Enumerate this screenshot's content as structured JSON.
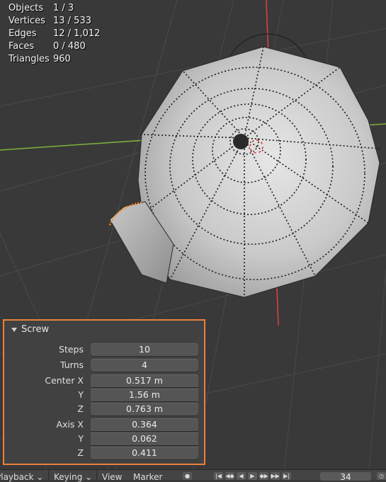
{
  "stats": {
    "objects_label": "Objects",
    "objects_value": "1 / 3",
    "vertices_label": "Vertices",
    "vertices_value": "13 / 533",
    "edges_label": "Edges",
    "edges_value": "12 / 1,012",
    "faces_label": "Faces",
    "faces_value": "0 / 480",
    "triangles_label": "Triangles",
    "triangles_value": "960"
  },
  "panel": {
    "title": "Screw",
    "steps_label": "Steps",
    "steps_value": "10",
    "turns_label": "Turns",
    "turns_value": "4",
    "center_x_label": "Center X",
    "center_x_value": "0.517 m",
    "center_y_label": "Y",
    "center_y_value": "1.56 m",
    "center_z_label": "Z",
    "center_z_value": "0.763 m",
    "axis_x_label": "Axis X",
    "axis_x_value": "0.364",
    "axis_y_label": "Y",
    "axis_y_value": "0.062",
    "axis_z_label": "Z",
    "axis_z_value": "0.411"
  },
  "timeline": {
    "playback": "Playback",
    "keying": "Keying",
    "view": "View",
    "marker": "Marker",
    "frame": "34"
  },
  "colors": {
    "panel_border": "#e9813e",
    "axis_red": "#e04040",
    "axis_green": "#7fb33a",
    "selection_orange": "#f28a1e"
  }
}
